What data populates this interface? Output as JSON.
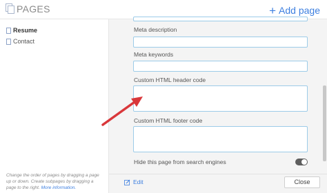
{
  "header": {
    "title": "PAGES",
    "add_page_label": "Add page",
    "add_page_symbol": "+"
  },
  "sidebar": {
    "items": [
      {
        "label": "Resume",
        "active": true
      },
      {
        "label": "Contact",
        "active": false
      }
    ],
    "help_text": "Change the order of pages by dragging a page up or down. Create subpages by dragging a page to the right.",
    "help_link": "More information."
  },
  "form": {
    "meta_description_label": "Meta description",
    "meta_keywords_label": "Meta keywords",
    "custom_header_label": "Custom HTML header code",
    "custom_footer_label": "Custom HTML footer code",
    "hide_search_label": "Hide this page from search engines",
    "meta_description_value": "",
    "meta_keywords_value": "",
    "custom_header_value": "",
    "custom_footer_value": ""
  },
  "footer": {
    "edit_label": "Edit",
    "close_label": "Close"
  },
  "colors": {
    "accent": "#3d7fe0",
    "annotation_arrow": "#d9373a",
    "field_border": "#9ccbe8",
    "toggle_off": "#5e5e5e"
  }
}
